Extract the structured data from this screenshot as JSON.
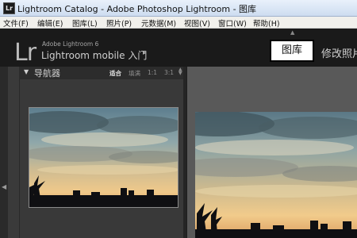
{
  "window": {
    "title": "Lightroom Catalog - Adobe Photoshop Lightroom - 图库",
    "app_icon": "Lr"
  },
  "menu": {
    "items": [
      "文件(F)",
      "编辑(E)",
      "图库(L)",
      "照片(P)",
      "元数据(M)",
      "视图(V)",
      "窗口(W)",
      "帮助(H)"
    ]
  },
  "identity": {
    "logo": "Lr",
    "product": "Adobe Lightroom 6",
    "subtitle": "Lightroom mobile 入门",
    "arrow": "▸"
  },
  "modules": {
    "active": "图库",
    "next": "修改照片"
  },
  "navigator": {
    "title": "导航器",
    "collapse_glyph": "▼",
    "options": [
      "适合",
      "填满",
      "1:1",
      "3:1"
    ],
    "active_option": "适合"
  },
  "colors": {
    "active_module_bg": "#ffffff",
    "panel_bg": "#3a3a3a",
    "center_bg": "#595959"
  }
}
